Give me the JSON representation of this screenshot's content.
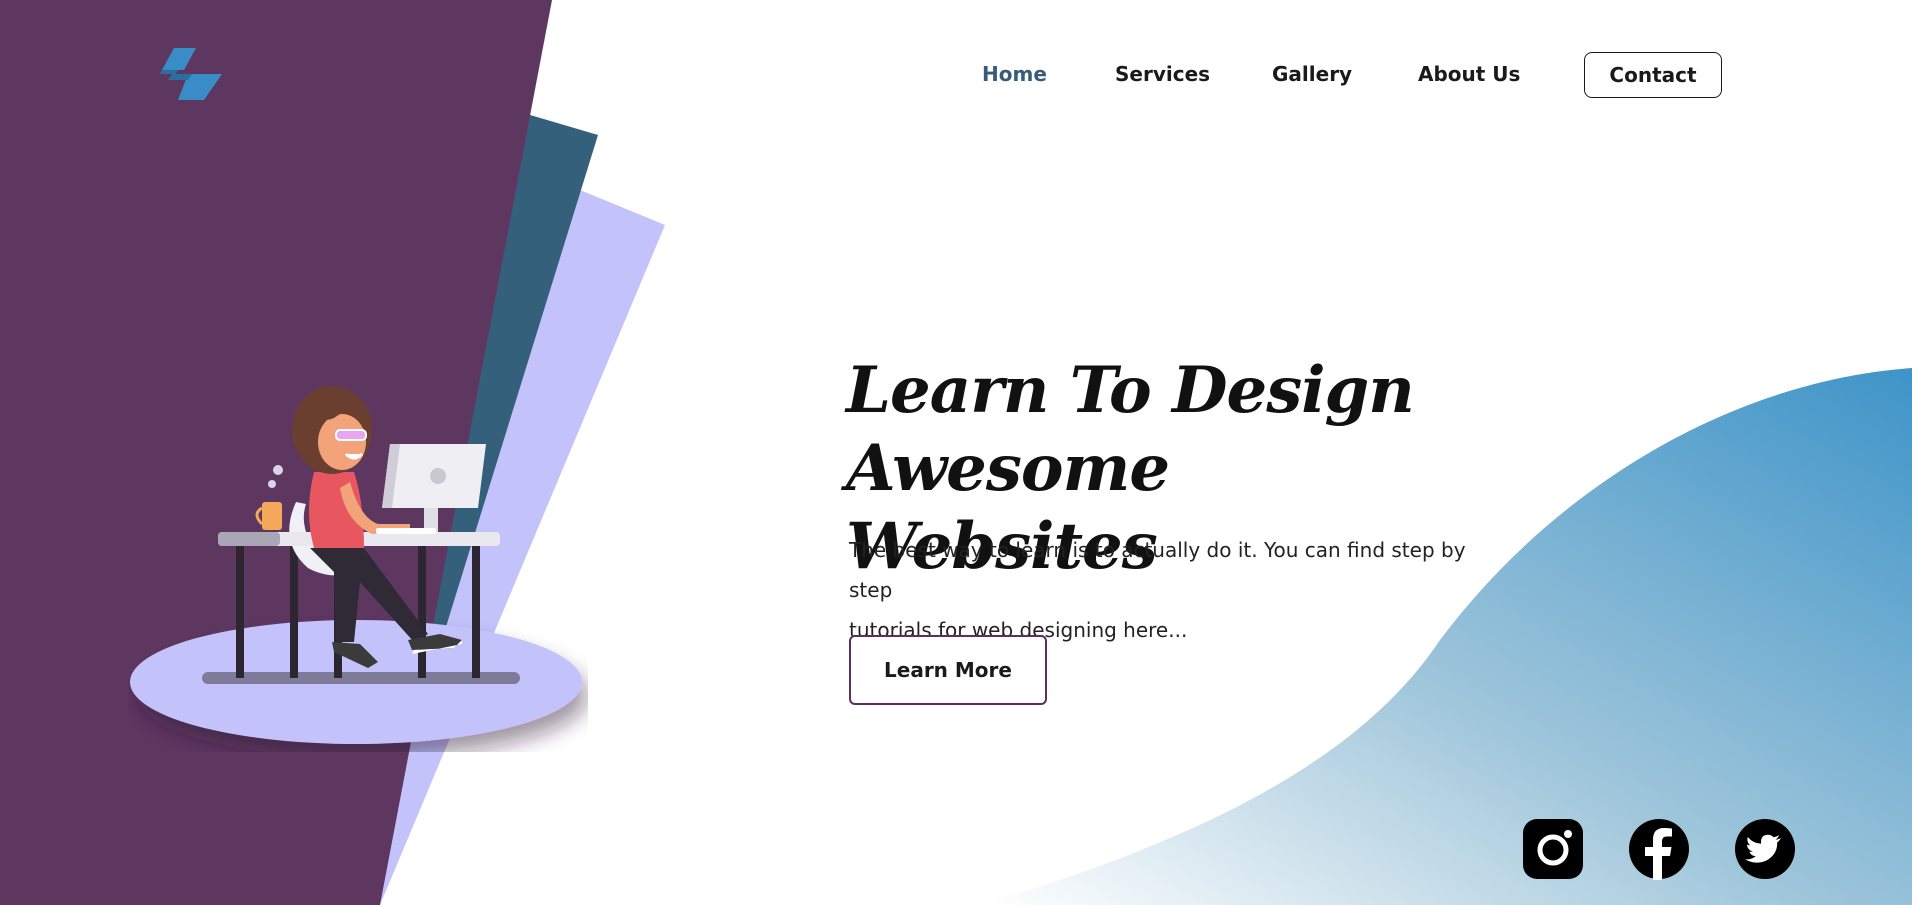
{
  "brand": {
    "logo_icon": "zigzag-logo-icon",
    "colors": {
      "purple": "#5e3761",
      "teal": "#35607b",
      "lavender": "#c4c2fb",
      "blue": "#4398c9",
      "dark": "#111111"
    }
  },
  "nav": {
    "items": [
      {
        "label": "Home",
        "active": true
      },
      {
        "label": "Services",
        "active": false
      },
      {
        "label": "Gallery",
        "active": false
      },
      {
        "label": "About Us",
        "active": false
      }
    ],
    "contact_label": "Contact"
  },
  "hero": {
    "title_line1": "Learn To Design",
    "title_line2": "Awesome Websites",
    "description_line1": "The best way to learn is to actually do it. You can find step by step",
    "description_line2": "tutorials for web designing here...",
    "cta_label": "Learn More"
  },
  "illustration": {
    "icon": "woman-working-at-computer-illustration"
  },
  "social": {
    "icons": [
      "instagram-icon",
      "facebook-icon",
      "twitter-icon"
    ]
  }
}
